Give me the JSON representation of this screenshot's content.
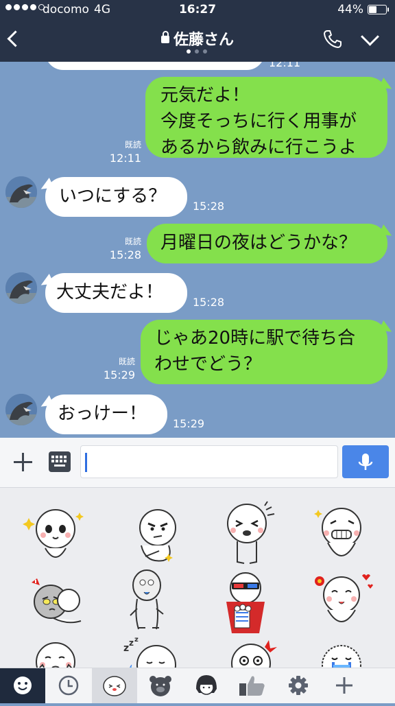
{
  "status_bar": {
    "carrier": "docomo",
    "network": "4G",
    "time": "16:27",
    "battery": "44%",
    "battery_level": 0.44,
    "signal_bars": 4
  },
  "header": {
    "title": "佐藤さん",
    "page_dots": 3,
    "active_dot": 1,
    "icons": [
      "chevron-left-icon",
      "lock-icon",
      "phone-icon",
      "chevron-down-icon"
    ]
  },
  "messages": [
    {
      "dir": "out",
      "lines": [
        "元気だよ！",
        "今度そっちに行く用事が",
        "あるから飲みに行こうよ"
      ],
      "read": "既読",
      "time": "12:11"
    },
    {
      "dir": "in",
      "text": "いつにする？",
      "time": "15:28"
    },
    {
      "dir": "out",
      "lines": [
        "月曜日の夜はどうかな？"
      ],
      "read": "既読",
      "time": "15:28"
    },
    {
      "dir": "in",
      "text": "大丈夫だよ！",
      "time": "15:28"
    },
    {
      "dir": "out",
      "lines": [
        "じゃあ20時に駅で待ち合",
        "わせでどう？"
      ],
      "read": "既読",
      "time": "15:29"
    },
    {
      "dir": "in",
      "text": "おっけー！",
      "time": "15:29"
    }
  ],
  "partial_top_time": "12:11",
  "input": {
    "value": "",
    "icons": [
      "plus-icon",
      "keyboard-icon",
      "microphone-icon"
    ]
  },
  "stickers": {
    "count_visible": 12,
    "names": [
      "sticker-excited",
      "sticker-smug",
      "sticker-laughing",
      "sticker-grinning",
      "sticker-sweating",
      "sticker-zombie",
      "sticker-popcorn-3d",
      "sticker-blushing",
      "sticker-blowing-kiss",
      "sticker-sleeping",
      "sticker-shocked",
      "sticker-crying"
    ]
  },
  "tabbar": {
    "icons": [
      "emoji-icon",
      "clock-icon",
      "sticker-face-icon",
      "bear-icon",
      "girl-icon",
      "thumbs-up-icon",
      "gear-icon",
      "plus-icon"
    ],
    "active_index": 2
  },
  "colors": {
    "header_bg": "#283347",
    "chat_bg": "#7a9cc6",
    "outgoing_bubble": "#84e04c",
    "incoming_bubble": "#ffffff",
    "mic_button": "#4a86e8"
  }
}
